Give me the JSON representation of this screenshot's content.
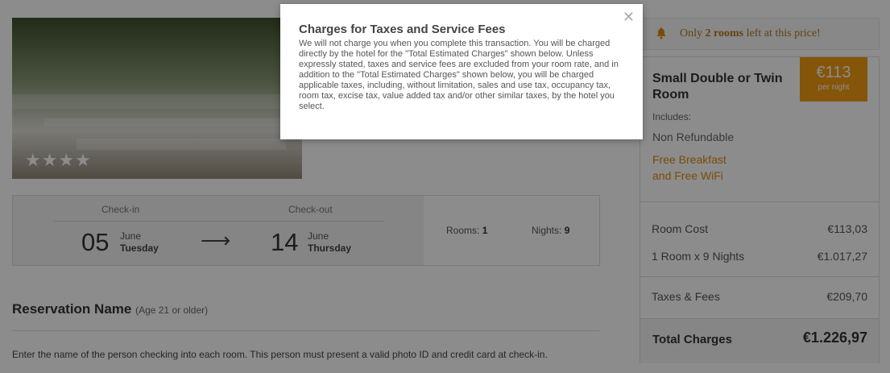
{
  "hotel": {
    "stars": "★★★★",
    "star_count": 4
  },
  "stay": {
    "checkin_label": "Check-in",
    "checkout_label": "Check-out",
    "checkin_day": "05",
    "checkin_month": "June",
    "checkin_weekday": "Tuesday",
    "checkout_day": "14",
    "checkout_month": "June",
    "checkout_weekday": "Thursday",
    "arrow": "⟶",
    "rooms_label": "Rooms:",
    "rooms_value": "1",
    "nights_label": "Nights:",
    "nights_value": "9"
  },
  "reservation": {
    "title": "Reservation Name",
    "age_note": "(Age 21 or older)",
    "instructions": "Enter the name of the person checking into each room. This person must present a valid photo ID and credit card at check-in."
  },
  "alert": {
    "prefix": "Only",
    "highlight": "2 rooms",
    "suffix": "left at this price!"
  },
  "room": {
    "name": "Small Double or Twin Room",
    "price": "€113",
    "price_unit": "per night",
    "includes_label": "Includes:",
    "refund_policy": "Non Refundable",
    "perk_line1": "Free Breakfast",
    "perk_line2": "and Free WiFi"
  },
  "costs": {
    "room_cost_label": "Room Cost",
    "room_cost_value": "€113,03",
    "nights_calc_label": "1 Room x 9 Nights",
    "nights_calc_value": "€1.017,27",
    "taxes_label": "Taxes & Fees",
    "taxes_value": "€209,70",
    "total_label": "Total Charges",
    "total_value": "€1.226,97"
  },
  "modal": {
    "close": "✕",
    "title": "Charges for Taxes and Service Fees",
    "body": "We will not charge you when you complete this transaction. You will be charged directly by the hotel for the \"Total Estimated Charges\" shown below. Unless expressly stated, taxes and service fees are excluded from your room rate, and in addition to the \"Total Estimated Charges\" shown below, you will be charged applicable taxes, including, without limitation, sales and use tax, occupancy tax, room tax, excise tax, value added tax and/or other similar taxes, by the hotel you select."
  },
  "colors": {
    "accent": "#f39c12",
    "perk": "#e08a10",
    "alert_text": "#b07c1e",
    "overlay": "rgba(0,0,0,0.45)"
  },
  "icons": {
    "alert": "bell-icon",
    "close": "close-icon",
    "arrow": "arrow-right-icon"
  }
}
